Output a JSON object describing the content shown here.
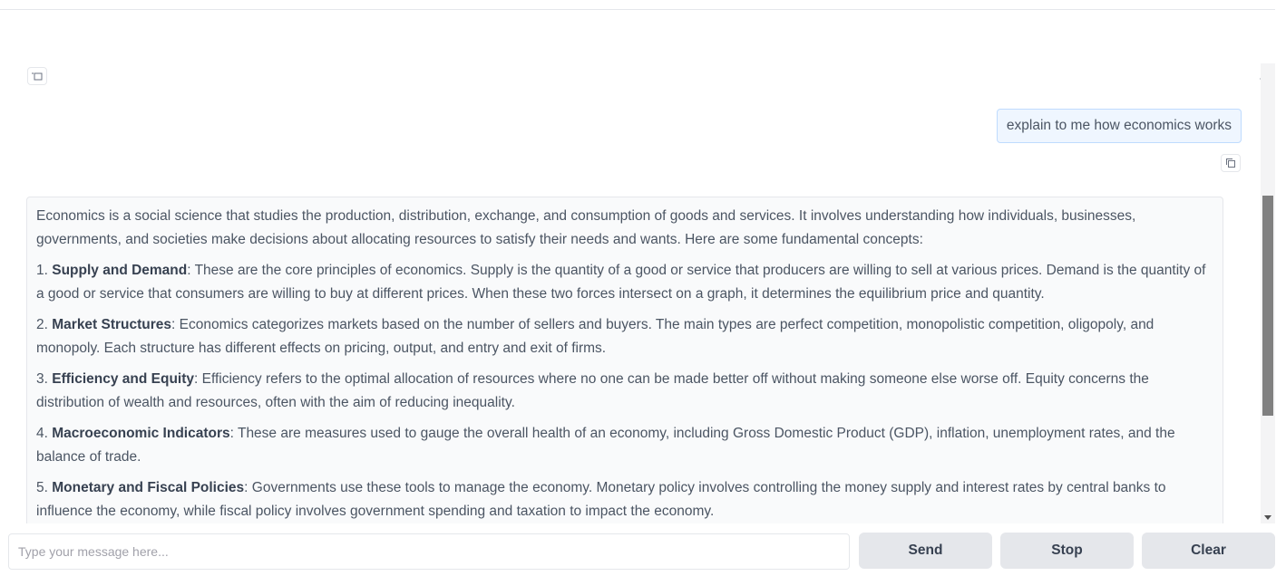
{
  "chat": {
    "user_message": "explain to me how economics works",
    "assistant": {
      "intro": "Economics is a social science that studies the production, distribution, exchange, and consumption of goods and services. It involves understanding how individuals, businesses, governments, and societies make decisions about allocating resources to satisfy their needs and wants. Here are some fundamental concepts:",
      "points": [
        {
          "number": "1.",
          "title": "Supply and Demand",
          "text": ": These are the core principles of economics. Supply is the quantity of a good or service that producers are willing to sell at various prices. Demand is the quantity of a good or service that consumers are willing to buy at different prices. When these two forces intersect on a graph, it determines the equilibrium price and quantity."
        },
        {
          "number": "2.",
          "title": "Market Structures",
          "text": ": Economics categorizes markets based on the number of sellers and buyers. The main types are perfect competition, monopolistic competition, oligopoly, and monopoly. Each structure has different effects on pricing, output, and entry and exit of firms."
        },
        {
          "number": "3.",
          "title": "Efficiency and Equity",
          "text": ": Efficiency refers to the optimal allocation of resources where no one can be made better off without making someone else worse off. Equity concerns the distribution of wealth and resources, often with the aim of reducing inequality."
        },
        {
          "number": "4.",
          "title": "Macroeconomic Indicators",
          "text": ": These are measures used to gauge the overall health of an economy, including Gross Domestic Product (GDP), inflation, unemployment rates, and the balance of trade."
        },
        {
          "number": "5.",
          "title": "Monetary and Fiscal Policies",
          "text": ": Governments use these tools to manage the economy. Monetary policy involves controlling the money supply and interest rates by central banks to influence the economy, while fiscal policy involves government spending and taxation to impact the economy."
        }
      ]
    }
  },
  "icons": {
    "top_left": "copy-all-icon",
    "top_right": "trash-icon",
    "message_copy": "copy-icon"
  },
  "input": {
    "placeholder": "Type your message here...",
    "value": ""
  },
  "buttons": {
    "send": "Send",
    "stop": "Stop",
    "clear": "Clear"
  }
}
